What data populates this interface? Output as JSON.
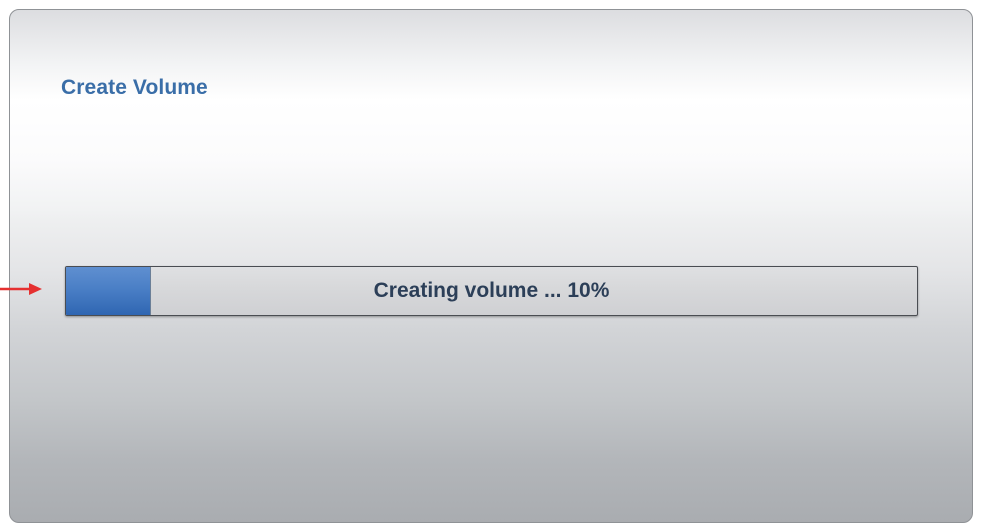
{
  "dialog": {
    "title": "Create Volume"
  },
  "progress": {
    "label": "Creating volume ... 10%",
    "fraction": 0.1
  },
  "colors": {
    "title": "#3a6ea8",
    "progress_fill": "#4a7fc6",
    "arrow": "#e53030"
  },
  "icons": {
    "pointer": "red-arrow-icon"
  }
}
